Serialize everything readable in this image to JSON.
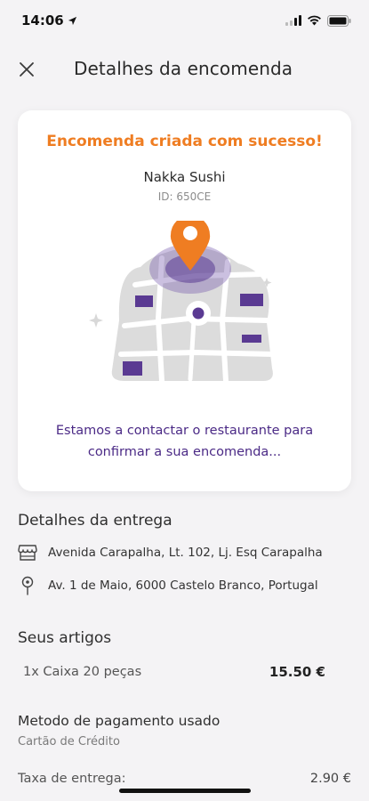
{
  "status": {
    "time": "14:06"
  },
  "header": {
    "title": "Detalhes da encomenda"
  },
  "order": {
    "success_message": "Encomenda criada com sucesso!",
    "restaurant": "Nakka Sushi",
    "id_label": "ID: 650CE",
    "status_message_line1": "Estamos a contactar o restaurante para",
    "status_message_line2": "confirmar a sua encomenda..."
  },
  "delivery": {
    "title": "Detalhes da entrega",
    "restaurant_address": "Avenida Carapalha, Lt. 102, Lj. Esq Carapalha",
    "customer_address": "Av. 1 de Maio, 6000 Castelo Branco, Portugal"
  },
  "items": {
    "title": "Seus artigos",
    "list": [
      {
        "name": "1x Caixa 20 peças",
        "price": "15.50 €"
      }
    ]
  },
  "payment": {
    "title": "Metodo de pagamento usado",
    "method": "Cartão de Crédito"
  },
  "fees": {
    "delivery_label": "Taxa de entrega:",
    "delivery_value": "2.90 €"
  },
  "colors": {
    "accent_orange": "#ef7d22",
    "brand_purple": "#4b2a86",
    "background": "#f4f3f5"
  },
  "icons": {
    "close": "close-icon",
    "store": "store-icon",
    "pin": "location-pin-icon",
    "map": "map-illustration"
  }
}
